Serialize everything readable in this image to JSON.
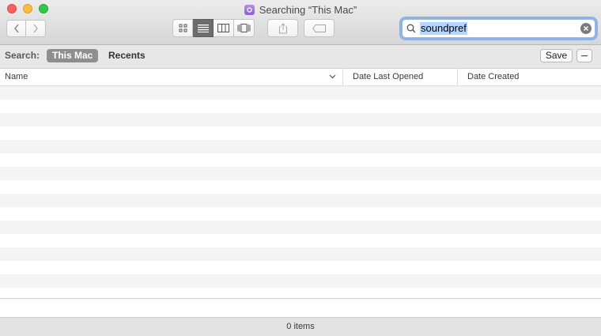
{
  "window": {
    "title": "Searching “This Mac”"
  },
  "toolbar": {
    "view_modes": [
      "icon-view",
      "list-view",
      "column-view",
      "cover-flow-view"
    ],
    "active_view": "list-view"
  },
  "search": {
    "value": "soundpref"
  },
  "scope": {
    "label": "Search:",
    "this_mac": "This Mac",
    "recents": "Recents",
    "save": "Save"
  },
  "columns": {
    "name": "Name",
    "date_last_opened": "Date Last Opened",
    "date_created": "Date Created"
  },
  "status": {
    "items": "0 items"
  },
  "colors": {
    "accent": "#8ab4e8",
    "selection": "#b4d5fe",
    "close": "#fc605c",
    "minimize": "#fdbc40",
    "maximize": "#34c84a"
  }
}
